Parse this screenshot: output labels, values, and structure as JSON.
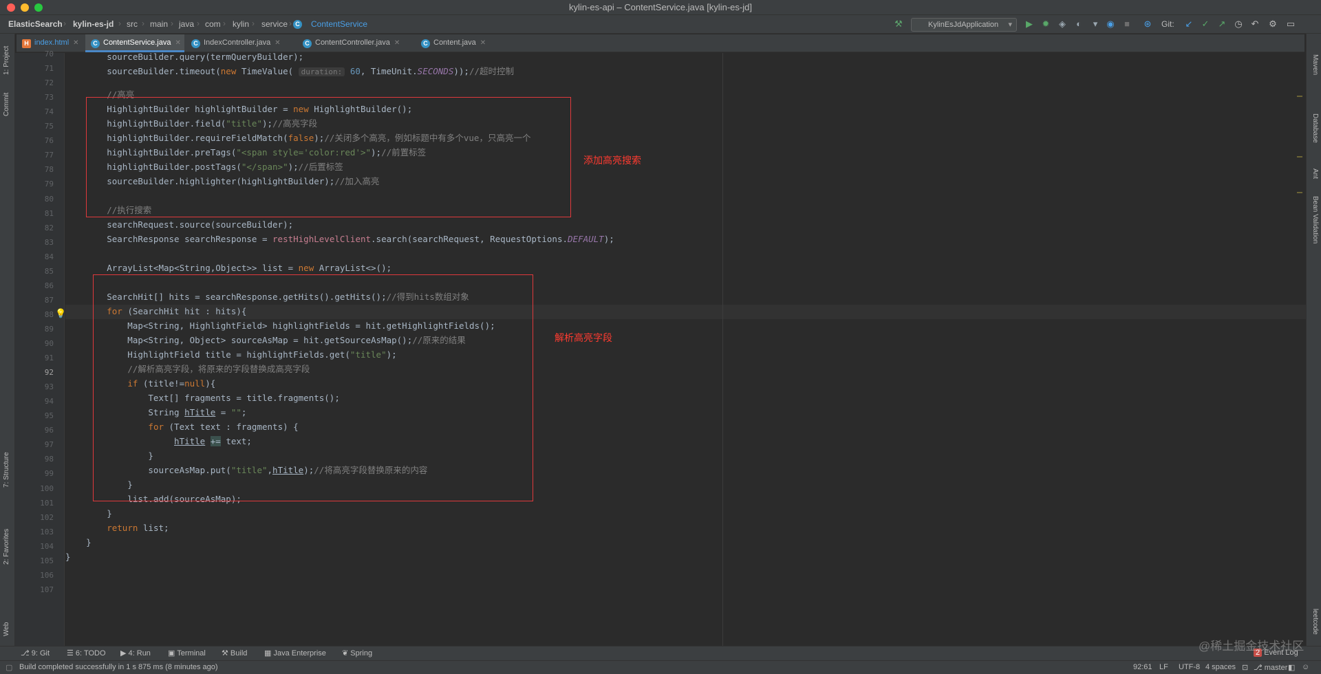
{
  "window": {
    "title": "kylin-es-api – ContentService.java [kylin-es-jd]"
  },
  "breadcrumb": [
    "ElasticSearch",
    "kylin-es-jd",
    "src",
    "main",
    "java",
    "com",
    "kylin",
    "service",
    "ContentService"
  ],
  "toolbar": {
    "run_config": "KylinEsJdApplication",
    "git_label": "Git:"
  },
  "tabs": [
    {
      "label": "index.html"
    },
    {
      "label": "ContentService.java"
    },
    {
      "label": "IndexController.java"
    },
    {
      "label": "ContentController.java"
    },
    {
      "label": "Content.java"
    }
  ],
  "left_tools": [
    "1: Project",
    "Commit",
    "7: Structure",
    "2: Favorites",
    "Web"
  ],
  "right_tools": [
    "Maven",
    "Database",
    "Ant",
    "Bean Validation",
    "leetcode"
  ],
  "line_numbers": [
    "70",
    "71",
    "72",
    "73",
    "74",
    "75",
    "76",
    "77",
    "78",
    "79",
    "80",
    "81",
    "82",
    "83",
    "84",
    "85",
    "86",
    "87",
    "88",
    "89",
    "90",
    "91",
    "92",
    "93",
    "94",
    "95",
    "96",
    "97",
    "98",
    "99",
    "100",
    "101",
    "102",
    "103",
    "104",
    "105",
    "106",
    "107"
  ],
  "annotations": {
    "top": "添加高亮搜索",
    "bottom": "解析高亮字段"
  },
  "bottom_tools": [
    "9: Git",
    "6: TODO",
    "4: Run",
    "Terminal",
    "Build",
    "Java Enterprise",
    "Spring"
  ],
  "status": {
    "message": "Build completed successfully in 1 s 875 ms (8 minutes ago)",
    "position": "92:61",
    "line_sep": "LF",
    "encoding": "UTF-8",
    "indent": "4 spaces",
    "branch": "master",
    "event_log": "Event Log",
    "event_count": "2"
  },
  "watermark": "@稀土掘金技术社区"
}
